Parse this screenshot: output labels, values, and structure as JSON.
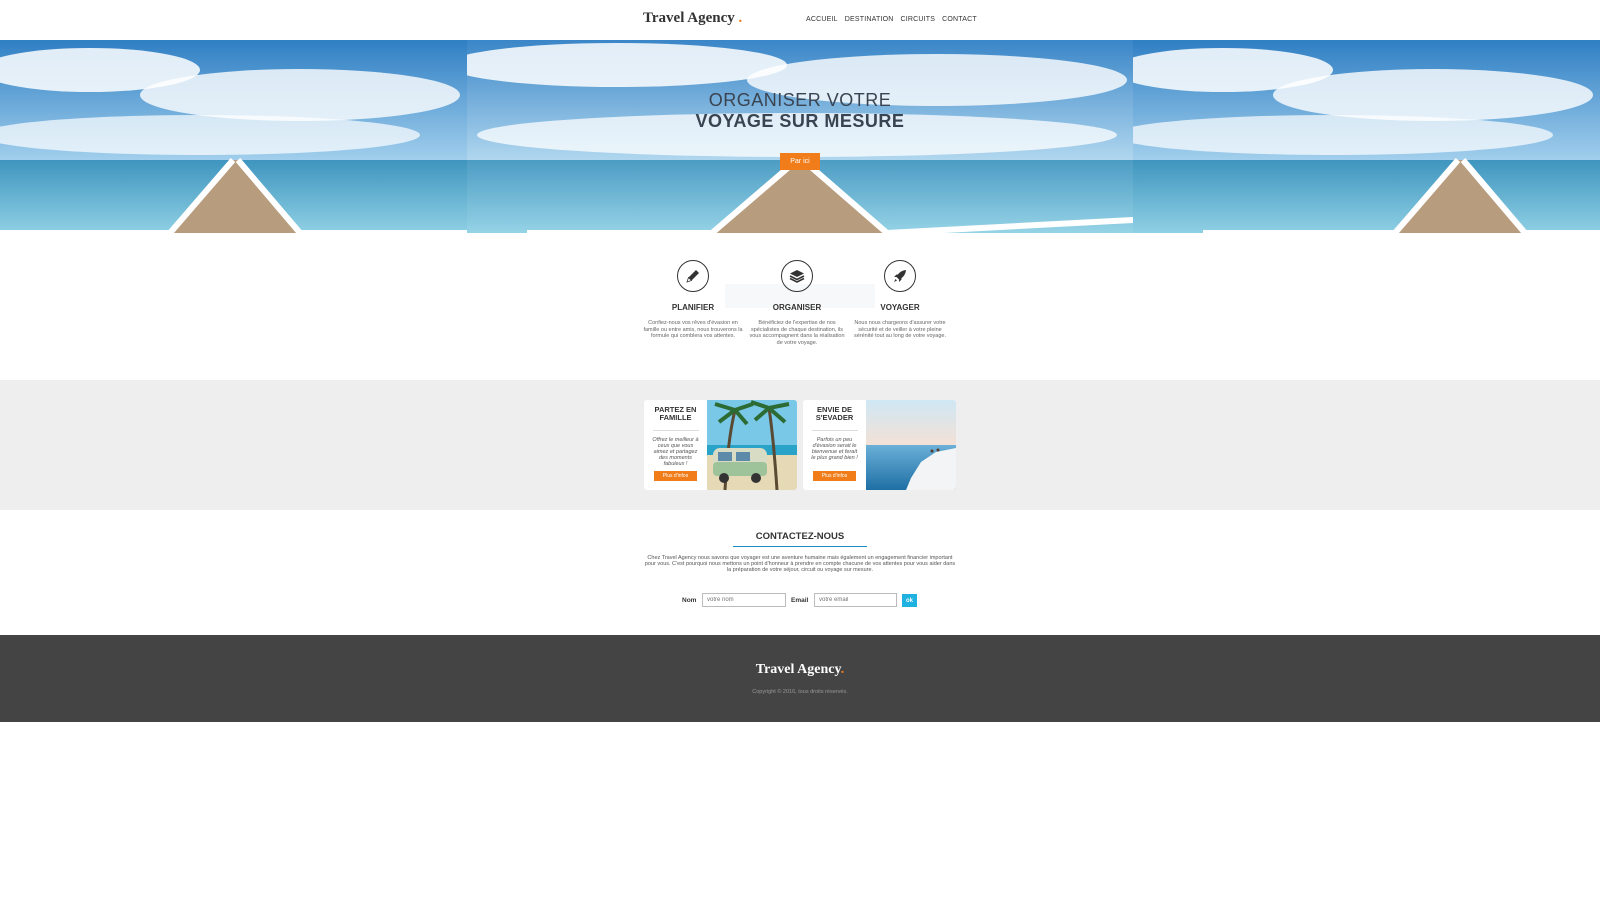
{
  "header": {
    "logo": "Travel Agency",
    "logo_dot": ".",
    "nav": [
      "ACCUEIL",
      "DESTINATION",
      "CIRCUITS",
      "CONTACT"
    ]
  },
  "hero": {
    "title_line1": "ORGANISER VOTRE",
    "title_line2": "VOYAGE SUR MESURE",
    "button": "Par ici"
  },
  "features": [
    {
      "icon": "pencil-icon",
      "title": "PLANIFIER",
      "text": "Confiez-nous vos rêves d'évasion en famille ou entre amis, nous trouverons la formule qui comblera vos attentes."
    },
    {
      "icon": "layers-icon",
      "title": "ORGANISER",
      "text": "Bénéficiez de l'expertise de nos spécialistes de chaque destination, ils vous accompagnent dans la réalisation de votre voyage."
    },
    {
      "icon": "rocket-icon",
      "title": "VOYAGER",
      "text": "Nous nous chargeons d'assurer votre sécurité et de veiller à votre pleine sérénité tout au long de votre voyage."
    }
  ],
  "cards": [
    {
      "title": "PARTEZ EN FAMILLE",
      "text": "Offrez le meilleur à ceux que vous aimez et partagez des moments fabuleux !",
      "button": "Plus d'infos"
    },
    {
      "title": "ENVIE DE S'EVADER",
      "text": "Parfois un peu d'évasion serait le bienvenue et ferait le plus grand bien !",
      "button": "Plus d'infos"
    }
  ],
  "contact": {
    "title": "CONTACTEZ-NOUS",
    "text": "Chez Travel Agency nous savons que voyager est une aventure humaine mais également un engagement financier important pour vous. C'est pourquoi nous mettons un point d'honneur à prendre en compte chacune de vos attentes pour vous aider dans la préparation de votre séjour, circuit ou voyage sur mesure.",
    "name_label": "Nom",
    "name_placeholder": "votre nom",
    "email_label": "Email",
    "email_placeholder": "votre email",
    "submit": "ok"
  },
  "footer": {
    "logo": "Travel Agency",
    "logo_dot": ".",
    "copyright": "Copyright © 2016, tous droits réservés."
  },
  "colors": {
    "accent": "#f07d1a",
    "link_blue": "#1a8ec7",
    "ok_button": "#1fb2e0",
    "footer_bg": "#444444",
    "band_bg": "#eeeeee"
  }
}
